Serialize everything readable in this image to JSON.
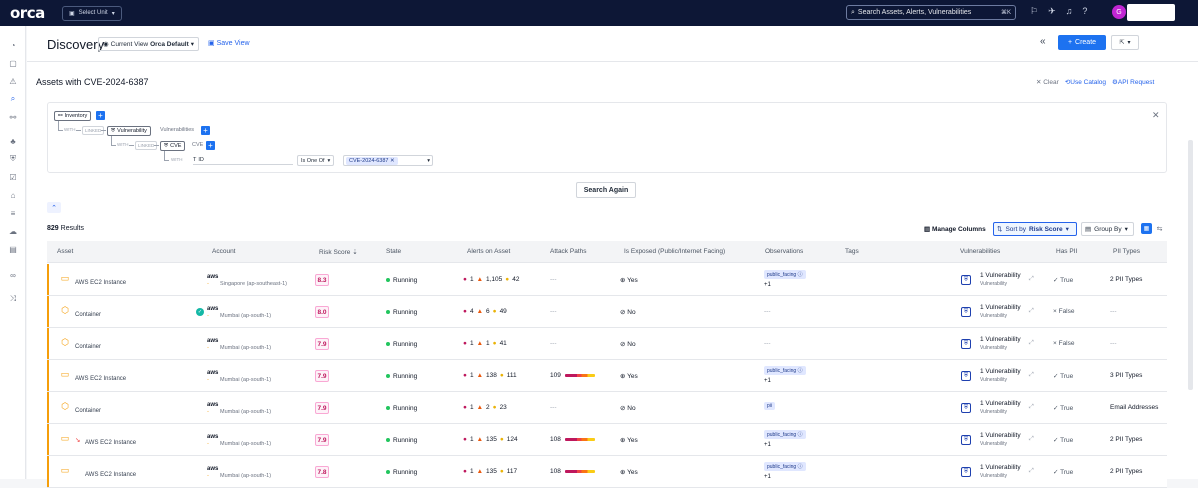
{
  "app": {
    "logo": "orca",
    "unit_select": "Select Unit"
  },
  "top_search": {
    "placeholder": "Search Assets, Alerts, Vulnerabilities",
    "shortcut": "⌘K"
  },
  "avatar": {
    "initial": "G"
  },
  "header": {
    "title": "Discovery",
    "current_view_label": "Current View",
    "current_view_value": "Orca Default",
    "save_view": "Save View",
    "create": "Create"
  },
  "query": {
    "title": "Assets with CVE-2024-6387",
    "clear": "Clear",
    "use_catalog": "Use Catalog",
    "api_request": "API Request",
    "inventory": "Inventory",
    "with": "WITH",
    "linked": "LINKED",
    "vulnerability": "Vulnerability",
    "vulnerabilities_label": "Vulnerabilities",
    "cve": "CVE",
    "cve_label": "CVE",
    "id_field": "ID",
    "operator": "Is One Of",
    "value": "CVE-2024-6387",
    "search_again": "Search Again"
  },
  "toolbar": {
    "results_count": "829",
    "results_label": "Results",
    "manage_columns": "Manage Columns",
    "sort_prefix": "Sort by",
    "sort_value": "Risk Score",
    "group_by": "Group By"
  },
  "table": {
    "headers": [
      "Asset",
      "Account",
      "Risk Score",
      "State",
      "Alerts on Asset",
      "Attack Paths",
      "Is Exposed (Public/Internet Facing)",
      "Observations",
      "Tags",
      "Vulnerabilities",
      "Has PII",
      "PII Types"
    ],
    "rows": [
      {
        "asset": "AWS EC2 Instance",
        "account": "Singapore (ap-southeast-1)",
        "score": "8.3",
        "state": "Running",
        "a1": "1",
        "a2": "1,105",
        "a3": "42",
        "attack": "---",
        "exposed": "Yes",
        "obs": "public_facing",
        "obs_more": "+1",
        "vuln": "1 Vulnerability",
        "vuln_sub": "Vulnerability",
        "has_pii": "True",
        "pii_types": "2 PII Types"
      },
      {
        "asset": "Container",
        "account": "Mumbai (ap-south-1)",
        "score": "8.0",
        "state": "Running",
        "a1": "4",
        "a2": "6",
        "a3": "49",
        "attack": "---",
        "exposed": "No",
        "obs": "---",
        "obs_more": "",
        "vuln": "1 Vulnerability",
        "vuln_sub": "Vulnerability",
        "has_pii": "False",
        "pii_types": "---"
      },
      {
        "asset": "Container",
        "account": "Mumbai (ap-south-1)",
        "score": "7.9",
        "state": "Running",
        "a1": "1",
        "a2": "1",
        "a3": "41",
        "attack": "---",
        "exposed": "No",
        "obs": "---",
        "obs_more": "",
        "vuln": "1 Vulnerability",
        "vuln_sub": "Vulnerability",
        "has_pii": "False",
        "pii_types": "---"
      },
      {
        "asset": "AWS EC2 Instance",
        "account": "Mumbai (ap-south-1)",
        "score": "7.9",
        "state": "Running",
        "a1": "1",
        "a2": "138",
        "a3": "111",
        "attack": "109",
        "exposed": "Yes",
        "obs": "public_facing",
        "obs_more": "+1",
        "vuln": "1 Vulnerability",
        "vuln_sub": "Vulnerability",
        "has_pii": "True",
        "pii_types": "3 PII Types"
      },
      {
        "asset": "Container",
        "account": "Mumbai (ap-south-1)",
        "score": "7.9",
        "state": "Running",
        "a1": "1",
        "a2": "2",
        "a3": "23",
        "attack": "---",
        "exposed": "No",
        "obs": "pii",
        "obs_more": "",
        "vuln": "1 Vulnerability",
        "vuln_sub": "Vulnerability",
        "has_pii": "True",
        "pii_types": "Email Addresses"
      },
      {
        "asset": "AWS EC2 Instance",
        "account": "Mumbai (ap-south-1)",
        "score": "7.9",
        "state": "Running",
        "a1": "1",
        "a2": "135",
        "a3": "124",
        "attack": "108",
        "exposed": "Yes",
        "obs": "public_facing",
        "obs_more": "+1",
        "vuln": "1 Vulnerability",
        "vuln_sub": "Vulnerability",
        "has_pii": "True",
        "pii_types": "2 PII Types"
      },
      {
        "asset": "AWS EC2 Instance",
        "account": "Mumbai (ap-south-1)",
        "score": "7.8",
        "state": "Running",
        "a1": "1",
        "a2": "135",
        "a3": "117",
        "attack": "108",
        "exposed": "Yes",
        "obs": "public_facing",
        "obs_more": "+1",
        "vuln": "1 Vulnerability",
        "vuln_sub": "Vulnerability",
        "has_pii": "True",
        "pii_types": "2 PII Types"
      }
    ]
  },
  "aws_label": "aws"
}
